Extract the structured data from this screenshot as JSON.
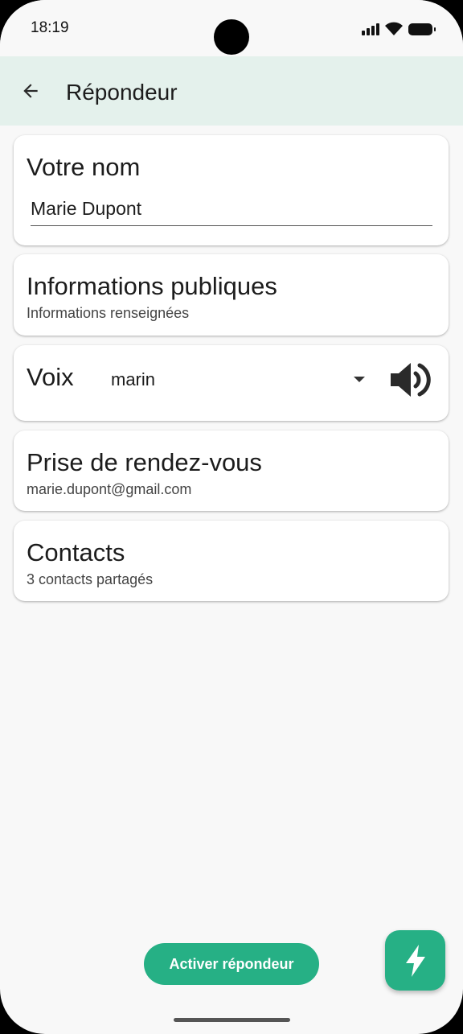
{
  "status_bar": {
    "time": "18:19"
  },
  "app_bar": {
    "title": "Répondeur"
  },
  "name_card": {
    "title": "Votre nom",
    "value": "Marie Dupont"
  },
  "public_info_card": {
    "title": "Informations publiques",
    "subtitle": "Informations renseignées"
  },
  "voice_card": {
    "title": "Voix",
    "selected": "marin"
  },
  "appointment_card": {
    "title": "Prise de rendez-vous",
    "subtitle": "marie.dupont@gmail.com"
  },
  "contacts_card": {
    "title": "Contacts",
    "subtitle": "3 contacts partagés"
  },
  "actions": {
    "activate_label": "Activer répondeur"
  },
  "icons": {
    "back": "arrow-back-icon",
    "voice_preview": "speaker-icon",
    "fab": "lightning-bolt-icon",
    "dropdown": "dropdown-arrow-icon"
  },
  "colors": {
    "accent": "#26b085",
    "app_bar_bg": "#e4f1ec",
    "background": "#f8f8f8"
  }
}
